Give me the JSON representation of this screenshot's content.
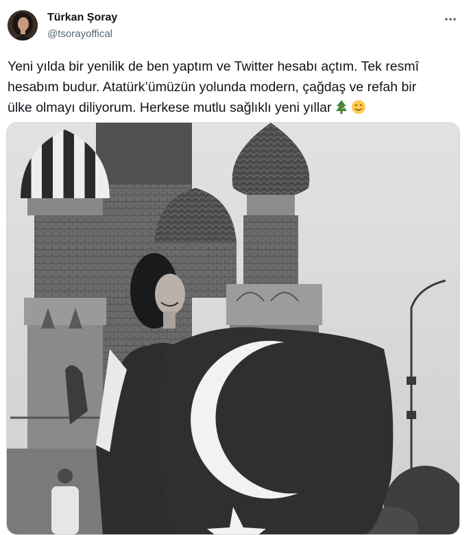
{
  "tweet": {
    "author_name": "Türkan Şoray",
    "author_handle": "@tsorayoffical",
    "text_lines": [
      "Yeni yılda bir yenilik de ben yaptım ve Twitter hesabı açtım. Tek resmî",
      "hesabım budur. Atatürk’ümüzün yolunda modern, çağdaş ve refah bir",
      "ülke olmayı diliyorum. Herkese mutlu sağlıklı yeni yıllar"
    ],
    "emojis": [
      "christmas-tree-icon",
      "smiling-face-icon"
    ]
  },
  "colors": {
    "text_primary": "#0f1419",
    "text_secondary": "#536471",
    "border": "#cfd9de"
  }
}
